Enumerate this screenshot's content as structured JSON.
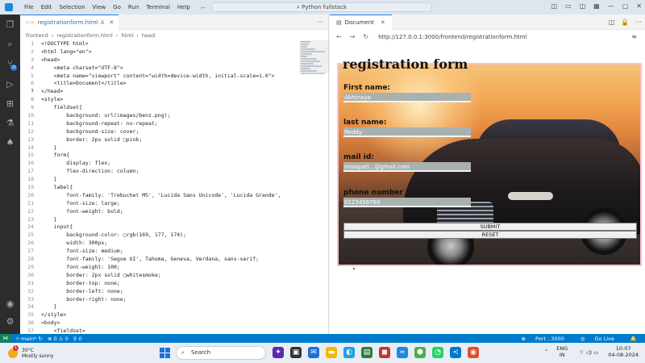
{
  "titlebar": {
    "menu": [
      "File",
      "Edit",
      "Selection",
      "View",
      "Go",
      "Run",
      "Terminal",
      "Help"
    ],
    "search": "Python fullstack"
  },
  "editor": {
    "tab_label": "registrationform.html",
    "tab_status": "A",
    "breadcrumb": [
      "frontend",
      "registrationform.html",
      "html",
      "head"
    ],
    "lines": [
      {
        "n": "1",
        "c": "<!DOCTYPE html>"
      },
      {
        "n": "2",
        "c": "<html lang=\"en\">"
      },
      {
        "n": "3",
        "c": "<head>"
      },
      {
        "n": "4",
        "c": "    <meta charset=\"UTF-8\">"
      },
      {
        "n": "5",
        "c": "    <meta name=\"viewport\" content=\"width=device-width, initial-scale=1.0\">"
      },
      {
        "n": "6",
        "c": "    <title>Document</title>"
      },
      {
        "n": "7",
        "c": "</head>"
      },
      {
        "n": "8",
        "c": "<style>"
      },
      {
        "n": "9",
        "c": "    fieldset{"
      },
      {
        "n": "10",
        "c": "        background: url(images/benz.png);"
      },
      {
        "n": "11",
        "c": "        background-repeat: no-repeat;"
      },
      {
        "n": "12",
        "c": "        background-size: cover;"
      },
      {
        "n": "13",
        "c": "        border: 2px solid ▢pink;"
      },
      {
        "n": "14",
        "c": "    }"
      },
      {
        "n": "15",
        "c": "    form{"
      },
      {
        "n": "16",
        "c": "        display: flex;"
      },
      {
        "n": "17",
        "c": "        flex-direction: column;"
      },
      {
        "n": "18",
        "c": "    }"
      },
      {
        "n": "19",
        "c": "    label{"
      },
      {
        "n": "20",
        "c": "        font-family: 'Trebuchet MS', 'Lucida Sans Unicode', 'Lucida Grande',"
      },
      {
        "n": "21",
        "c": "        font-size: large;"
      },
      {
        "n": "22",
        "c": "        font-weight: bold;"
      },
      {
        "n": "23",
        "c": "    }"
      },
      {
        "n": "24",
        "c": "    input{"
      },
      {
        "n": "25",
        "c": "        background-color: ▢rgb(169, 177, 174);"
      },
      {
        "n": "26",
        "c": "        width: 300px;"
      },
      {
        "n": "27",
        "c": "        font-size: medium;"
      },
      {
        "n": "28",
        "c": "        font-family: 'Segoe UI', Tahoma, Geneva, Verdana, sans-serif;"
      },
      {
        "n": "29",
        "c": "        font-weight: 100;"
      },
      {
        "n": "30",
        "c": "        border: 2px solid ▢whitesmoke;"
      },
      {
        "n": "31",
        "c": "        border-top: none;"
      },
      {
        "n": "32",
        "c": "        border-left: none;"
      },
      {
        "n": "33",
        "c": "        border-right: none;"
      },
      {
        "n": "34",
        "c": "    }"
      },
      {
        "n": "35",
        "c": "</style>"
      },
      {
        "n": "36",
        "c": "<body>"
      },
      {
        "n": "37",
        "c": "    <fieldset>"
      }
    ]
  },
  "preview": {
    "tab_label": "Document",
    "url": "http://127.0.0.1:3000/frontend/registrationform.html",
    "page_title": "registration form",
    "fields": [
      {
        "label": "First name:",
        "value": "Abhinaya"
      },
      {
        "label": "last name:",
        "value": "Reddy"
      },
      {
        "label": "mail id:",
        "value": "malapati...@gmail.com"
      },
      {
        "label": "phone number",
        "value": "0123456789"
      }
    ],
    "submit_label": "SUBMIT",
    "reset_label": "RESET"
  },
  "statusbar": {
    "branch": "main*",
    "problems": "⊗ 0 ⚠ 0",
    "ports": "⚲ 0",
    "port": "Port : 3000",
    "golive": "Go Live"
  },
  "taskbar": {
    "temp": "30°C",
    "weather": "Mostly sunny",
    "weather_badge": "1",
    "search_placeholder": "Search",
    "lang_line1": "ENG",
    "lang_line2": "IN",
    "time": "10:07",
    "date": "04-08-2024"
  },
  "colors": {
    "statusbar": "#007acc",
    "activity": "#2c2c2c",
    "fieldset_border": "pink",
    "input_bg": "rgb(169,177,174)"
  }
}
